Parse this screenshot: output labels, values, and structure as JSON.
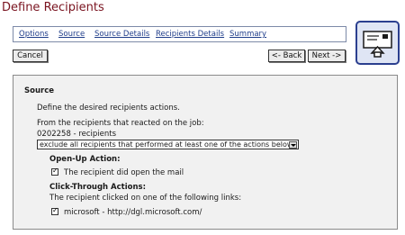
{
  "page_title": "Define Recipients",
  "tabs": [
    {
      "label": "Options"
    },
    {
      "label": "Source"
    },
    {
      "label": "Source Details"
    },
    {
      "label": "Recipients Details"
    },
    {
      "label": "Summary"
    }
  ],
  "buttons": {
    "cancel": "Cancel",
    "back": "<- Back",
    "next": "Next ->"
  },
  "wizard_icon": "recipients-wizard-icon",
  "section": {
    "title": "Source",
    "intro": "Define the desired recipients actions.",
    "from_label": "From the recipients that reacted on the job:",
    "job_info": "0202258 - recipients",
    "filter_select": "exclude all recipients that performed at least one of the actions below",
    "open_up_heading": "Open-Up Action:",
    "open_up_option": "The recipient did open the mail",
    "click_heading": "Click-Through Actions:",
    "click_desc": "The recipient clicked on one of the following links:",
    "link_option": "microsoft - http://dgl.microsoft.com/"
  },
  "colors": {
    "title": "#7a1420",
    "link": "#1f3d8a",
    "accent_border": "#2b3f8f"
  }
}
